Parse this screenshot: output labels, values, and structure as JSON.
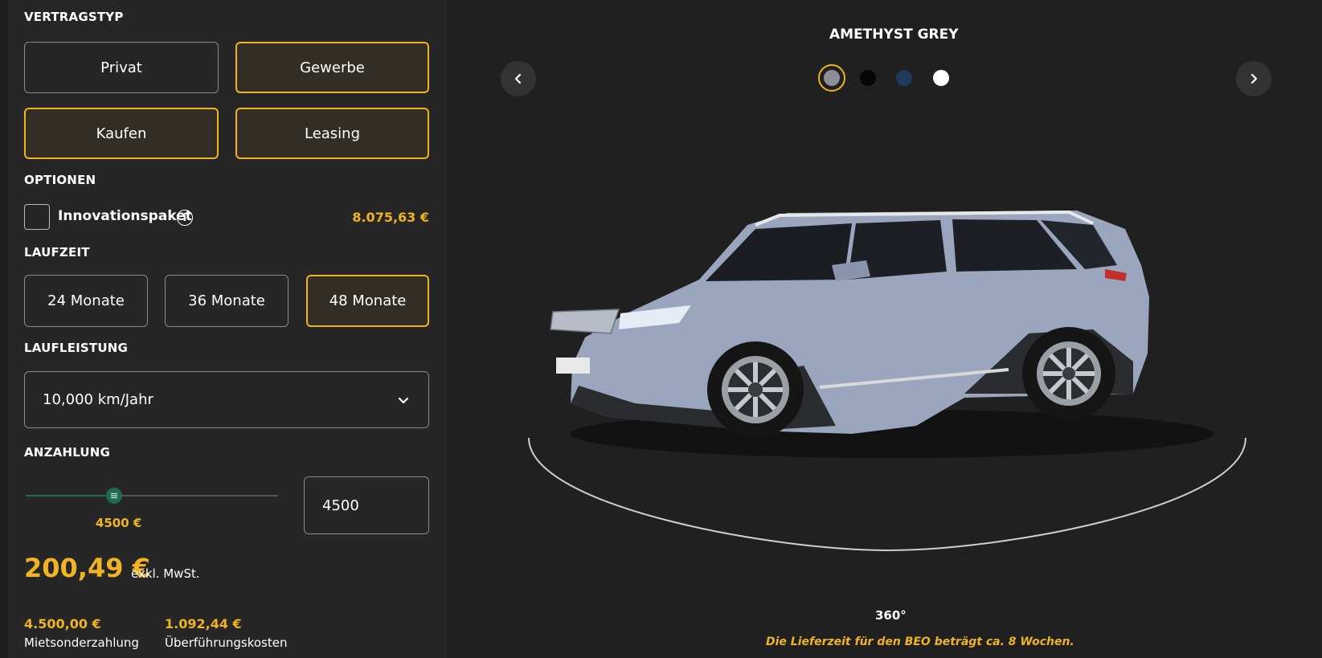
{
  "contract": {
    "label": "VERTRAGSTYP",
    "customer_types": [
      {
        "label": "Privat",
        "selected": false
      },
      {
        "label": "Gewerbe",
        "selected": true
      }
    ],
    "purchase_types": [
      {
        "label": "Kaufen",
        "selected": true
      },
      {
        "label": "Leasing",
        "selected": true
      }
    ]
  },
  "options": {
    "label": "OPTIONEN",
    "items": [
      {
        "name": "Innovationspaket",
        "price": "8.075,63 €",
        "checked": false,
        "icon": "info-icon",
        "icon_glyph": "i"
      }
    ]
  },
  "duration": {
    "label": "LAUFZEIT",
    "items": [
      {
        "label": "24 Monate",
        "selected": false
      },
      {
        "label": "36 Monate",
        "selected": false
      },
      {
        "label": "48 Monate",
        "selected": true
      }
    ]
  },
  "mileage": {
    "label": "LAUFLEISTUNG",
    "value": "10,000 km/Jahr",
    "icon": "chevron-down-icon"
  },
  "downpayment": {
    "label": "ANZAHLUNG",
    "slider_fraction": 0.35,
    "slider_label": "4500 €",
    "input_value": "4500"
  },
  "price": {
    "monthly": "200,49 €",
    "note": "exkl. MwSt."
  },
  "costs": [
    {
      "value": "4.500,00 €",
      "label": "Mietsonderzahlung"
    },
    {
      "value": "1.092,44 €",
      "label": "Überführungskosten"
    }
  ],
  "viewer": {
    "color_name": "AMETHYST GREY",
    "swatches": [
      {
        "color": "#8e8e96",
        "selected": true
      },
      {
        "color": "#050505",
        "selected": false
      },
      {
        "color": "#203a5e",
        "selected": false
      },
      {
        "color": "#ffffff",
        "selected": false
      }
    ],
    "prev_icon": "chevron-left-icon",
    "next_icon": "chevron-right-icon",
    "rotation_label": "360°",
    "delivery_note": "Die Lieferzeit für den BEO beträgt ca. 8 Wochen.",
    "car_color": "#9aa6be"
  },
  "colors": {
    "accent": "#f0b323",
    "slider": "#1f6b4f"
  }
}
